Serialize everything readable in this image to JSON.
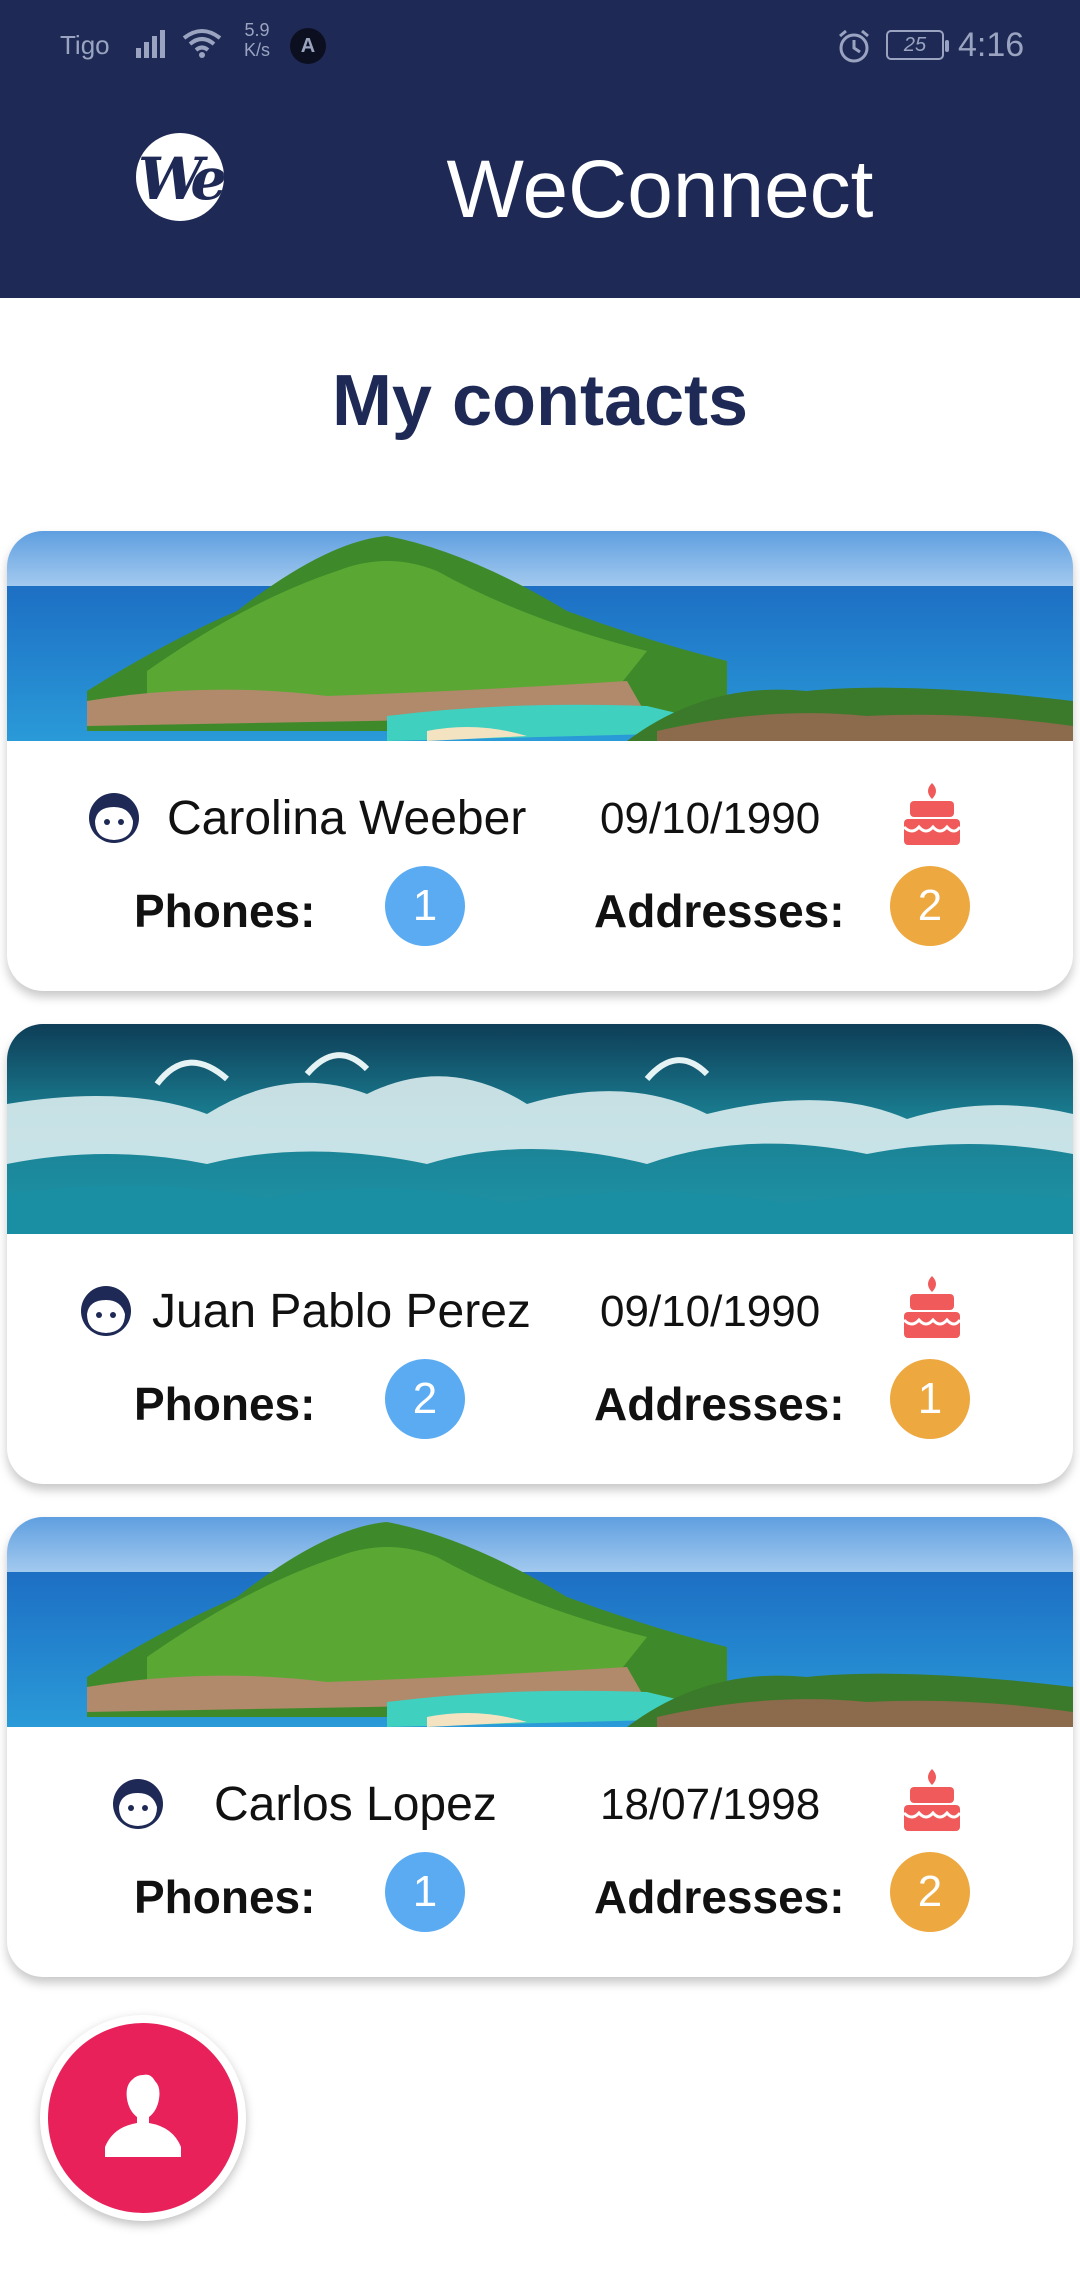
{
  "status_bar": {
    "carrier": "Tigo",
    "speed_value": "5.9",
    "speed_unit": "K/s",
    "app_icon_letter": "A",
    "battery": "25",
    "time": "4:16"
  },
  "header": {
    "logo_text": "We",
    "title": "WeConnect",
    "background_color": "#1e2a55"
  },
  "page": {
    "title": "My contacts"
  },
  "contacts": [
    {
      "name": "Carolina Weeber",
      "birthdate": "09/10/1990",
      "phones_label": "Phones:",
      "phones_count": "1",
      "addresses_label": "Addresses:",
      "addresses_count": "2",
      "image": "island-scene"
    },
    {
      "name": "Juan Pablo Perez",
      "birthdate": "09/10/1990",
      "phones_label": "Phones:",
      "phones_count": "2",
      "addresses_label": "Addresses:",
      "addresses_count": "1",
      "image": "ocean-wave"
    },
    {
      "name": "Carlos Lopez",
      "birthdate": "18/07/1998",
      "phones_label": "Phones:",
      "phones_count": "1",
      "addresses_label": "Addresses:",
      "addresses_count": "2",
      "image": "island-scene"
    }
  ],
  "icons": {
    "contact": "face-icon",
    "birthday": "cake-icon",
    "fab": "add-contact-icon"
  },
  "colors": {
    "accent_fab": "#e8215a",
    "phones_badge": "#5aabf2",
    "addresses_badge": "#eda840",
    "cake": "#f05a5a",
    "title": "#1e2a55"
  }
}
